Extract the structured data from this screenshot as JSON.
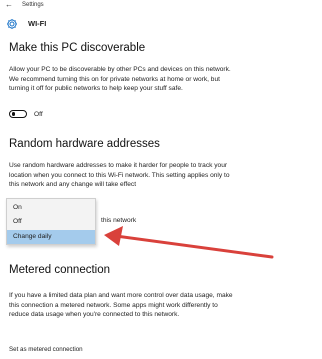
{
  "window": {
    "app_title": "Settings",
    "back_icon": "back-arrow-icon"
  },
  "header": {
    "title": "WI-FI",
    "icon": "gear-icon"
  },
  "discoverable": {
    "title": "Make this PC discoverable",
    "description": "Allow your PC to be discoverable by other PCs and devices on this network. We recommend turning this on for private networks at home or work, but turning it off for public networks to help keep your stuff safe.",
    "toggle_state": "Off"
  },
  "random_hw": {
    "title": "Random hardware addresses",
    "description": "Use random hardware addresses to make it harder for people to track your location when you connect to this Wi-Fi network. This setting applies only to this network and any change will take effect",
    "partial_text": "this network",
    "dropdown": {
      "options": [
        "On",
        "Off",
        "Change daily"
      ],
      "selected": "Change daily"
    },
    "arrow_color": "#d9413b"
  },
  "metered": {
    "title": "Metered connection",
    "description": "If you have a limited data plan and want more control over data usage, make this connection a metered network. Some apps might work differently to reduce data usage when you're connected to this network.",
    "set_label": "Set as metered connection"
  },
  "colors": {
    "selection": "#a4cbec",
    "accent": "#1a73c8"
  }
}
